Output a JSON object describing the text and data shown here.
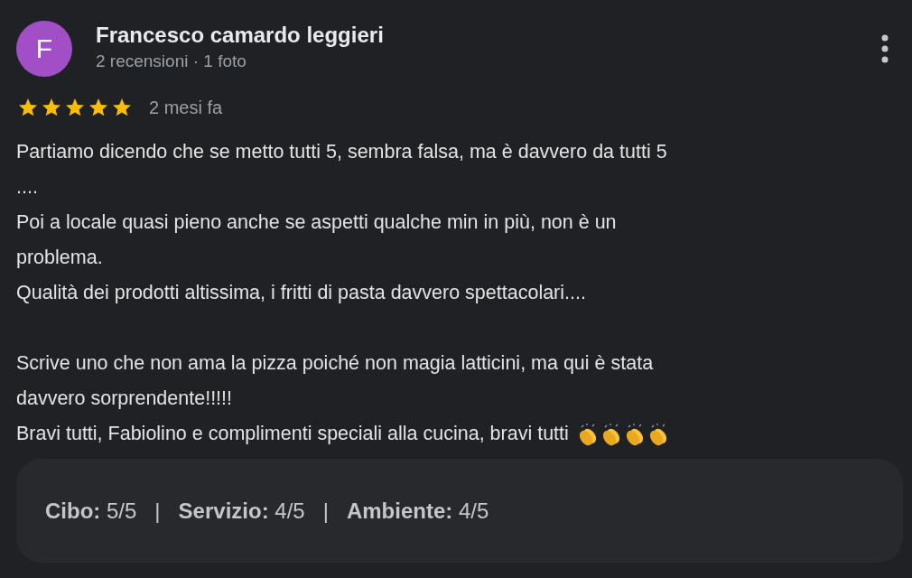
{
  "reviewer": {
    "initial": "F",
    "name": "Francesco camardo leggieri",
    "meta": "2 recensioni · 1 foto"
  },
  "rating": {
    "stars": 5,
    "time": "2 mesi fa"
  },
  "review_paragraphs": [
    {
      "lines": [
        {
          "text": "Partiamo dicendo che se metto tutti 5, sembra falsa, ma è davvero da tutti 5"
        },
        {
          "text": "...."
        },
        {
          "text": "Poi a locale quasi pieno anche se aspetti qualche min in più, non è un"
        },
        {
          "text": "problema."
        },
        {
          "text": "Qualità dei prodotti altissima, i fritti di pasta davvero spettacolari...."
        }
      ]
    },
    {
      "lines": [
        {
          "text": "Scrive uno che non ama la pizza poiché non magia latticini, ma qui è stata"
        },
        {
          "text": "davvero sorprendente!!!!!"
        },
        {
          "text": "Bravi tutti, Fabiolino e complimenti speciali alla cucina, bravi tutti",
          "trailing_icons": [
            {
              "kind": "clap"
            },
            {
              "kind": "clap"
            },
            {
              "kind": "clap"
            },
            {
              "kind": "clap"
            }
          ]
        }
      ]
    }
  ],
  "sub_ratings": [
    {
      "label": "Cibo:",
      "value": "5/5"
    },
    {
      "label": "Servizio:",
      "value": "4/5"
    },
    {
      "label": "Ambiente:",
      "value": "4/5"
    }
  ],
  "separators": [
    "|",
    "|"
  ]
}
